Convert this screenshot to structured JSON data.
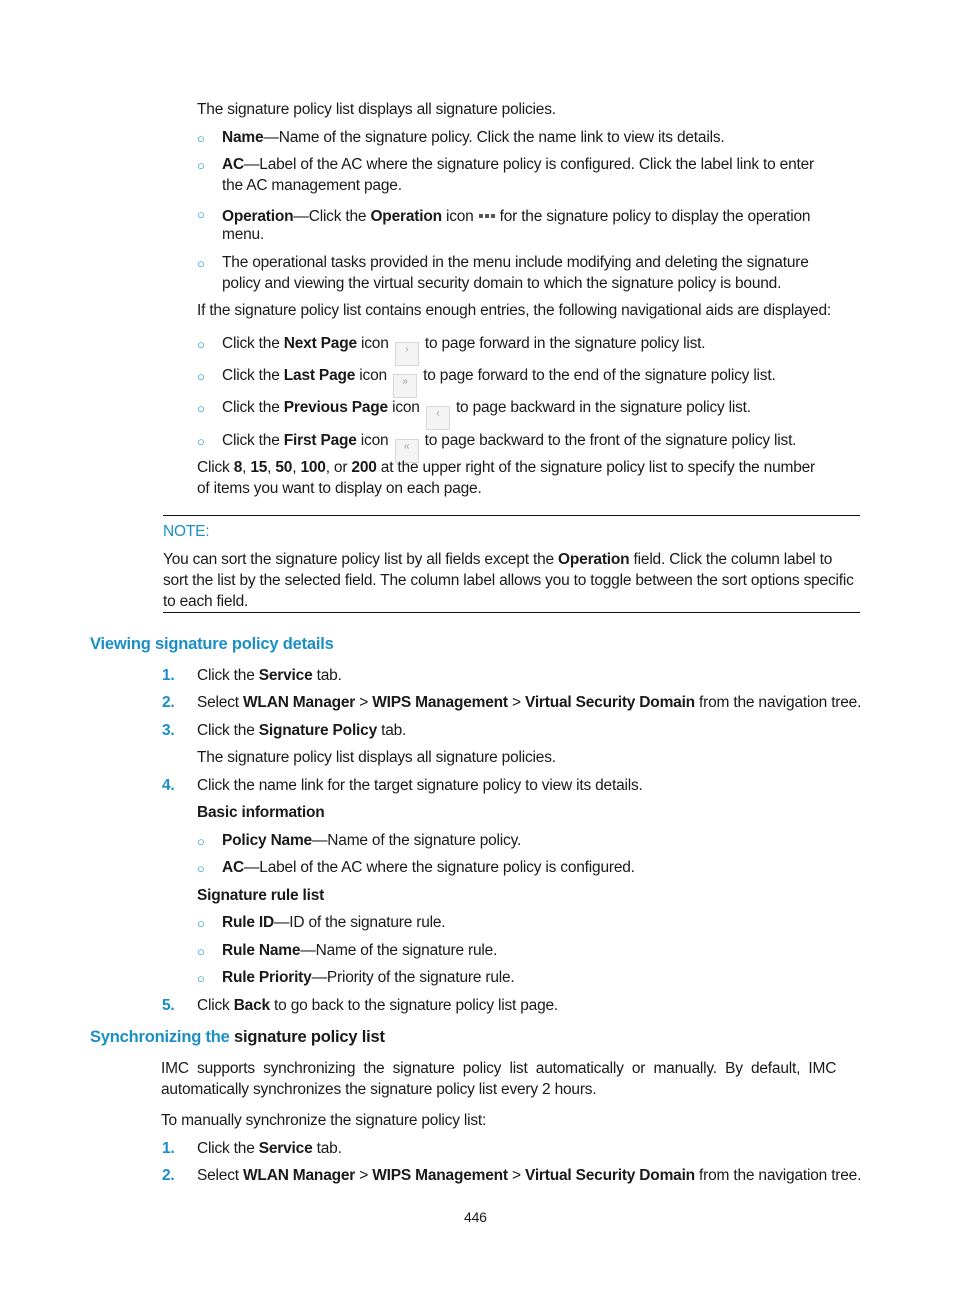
{
  "intro": {
    "text": "The signature policy list displays all signature policies.",
    "fields": [
      {
        "term": "Name",
        "desc": "—Name of the signature policy. Click the name link to view its details."
      },
      {
        "term": "AC",
        "desc": "—Label of the AC where the signature policy is configured. Click the label link to enter",
        "desc2": "the AC management page."
      },
      {
        "term": "Operation",
        "pre": "—Click the ",
        "term2": "Operation",
        "mid": " icon",
        "post": "for the signature policy to display the operation",
        "line2": "menu.",
        "icon": "more-dots-icon"
      },
      {
        "line1": "The operational tasks provided in the menu include modifying and deleting the signature",
        "line2": "policy and viewing the virtual security domain to which the signature policy is bound."
      }
    ]
  },
  "nav_aids": {
    "intro": "If the signature policy list contains enough entries, the following navigational aids are displayed:",
    "items": [
      {
        "pre": "Click the ",
        "term": "Next Page",
        "mid": " icon",
        "post": "to page forward in the signature policy list.",
        "glyph": "›",
        "icon": "next-page-icon"
      },
      {
        "pre": "Click the ",
        "term": "Last Page",
        "mid": " icon",
        "post": "to page forward to the end of the signature policy list.",
        "glyph": "»",
        "icon": "last-page-icon"
      },
      {
        "pre": "Click the ",
        "term": "Previous Page",
        "mid": " icon",
        "post": "to page backward in the signature policy list.",
        "glyph": "‹",
        "icon": "previous-page-icon"
      },
      {
        "pre": "Click the ",
        "term": "First Page",
        "mid": " icon",
        "post": "to page backward to the front of the signature policy list.",
        "glyph": "«",
        "icon": "first-page-icon"
      }
    ],
    "page_size": {
      "pre": "Click ",
      "options": [
        "8",
        "15",
        "50",
        "100",
        "200"
      ],
      "post": " at the upper right of the signature policy list to specify the number",
      "line2": "of items you want to display on each page."
    }
  },
  "note": {
    "title": "NOTE:",
    "line1_pre": "You can sort the signature policy list by all fields except the ",
    "line1_term": "Operation",
    "line1_post": " field. Click the column label to",
    "line2": "sort the list by the selected field. The column label allows you to toggle between the sort options specific",
    "line3": "to each field."
  },
  "section_view": {
    "heading": "Viewing signature policy details",
    "steps": [
      {
        "num": "1.",
        "pre": "Click the ",
        "term": "Service",
        "post": " tab."
      },
      {
        "num": "2.",
        "pre": "Select ",
        "t1": "WLAN Manager",
        "sep1": " > ",
        "t2": "WIPS Management",
        "sep2": " > ",
        "t3": "Virtual Security Domain",
        "post": " from the navigation tree."
      },
      {
        "num": "3.",
        "pre": "Click the ",
        "term": "Signature Policy",
        "post": " tab.",
        "sub": "The signature policy list displays all signature policies."
      },
      {
        "num": "4.",
        "text": "Click the name link for the target signature policy to view its details."
      },
      {
        "num": "5.",
        "pre": "Click ",
        "term": "Back",
        "post": " to go back to the signature policy list page."
      }
    ],
    "basic_info": {
      "title": "Basic information",
      "items": [
        {
          "term": "Policy Name",
          "desc": "—Name of the signature policy."
        },
        {
          "term": "AC",
          "desc": "—Label of the AC where the signature policy is configured."
        }
      ]
    },
    "rule_list": {
      "title": "Signature rule list",
      "items": [
        {
          "term": "Rule ID",
          "desc": "—ID of the signature rule."
        },
        {
          "term": "Rule Name",
          "desc": "—Name of the signature rule."
        },
        {
          "term": "Rule Priority",
          "desc": "—Priority of the signature rule."
        }
      ]
    }
  },
  "section_sync": {
    "heading_blue": "Synchronizing the",
    "heading_black": " signature policy list",
    "para_line1": "IMC  supports  synchronizing  the  signature  policy  list  automatically  or  manually.  By  default,  IMC",
    "para_line2": "automatically synchronizes the signature policy list every 2 hours.",
    "manual_intro": "To manually synchronize the signature policy list:",
    "steps": [
      {
        "num": "1.",
        "pre": "Click the ",
        "term": "Service",
        "post": " tab."
      },
      {
        "num": "2.",
        "pre": "Select ",
        "t1": "WLAN Manager",
        "sep1": " > ",
        "t2": "WIPS Management",
        "sep2": " > ",
        "t3": "Virtual Security Domain",
        "post": " from the navigation tree."
      }
    ]
  },
  "page_number": "446",
  "colors": {
    "accent": "#1a8fc6",
    "text": "#1a1a1a"
  }
}
